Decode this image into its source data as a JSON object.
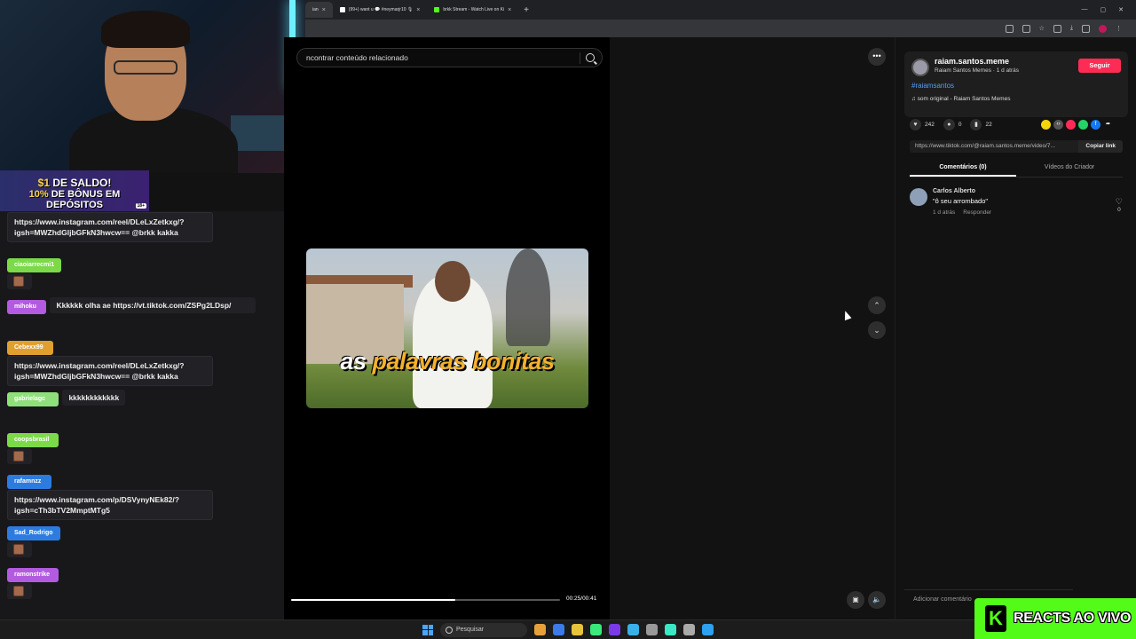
{
  "browser": {
    "tabs": [
      {
        "label": "ian",
        "active": true
      },
      {
        "label": "(99+) want u 💬 #neymarjr10 🎙",
        "active": false
      },
      {
        "label": "brkk Stream - Watch Live on Ki",
        "active": false
      }
    ],
    "new_tab": "+"
  },
  "promo": {
    "line1_hl": "$1",
    "line1_rest": " DE SALDO!",
    "line2_hl": "10%",
    "line2_rest": " DE BÔNUS EM DEPÓSITOS",
    "age_badge": "18+"
  },
  "chat": {
    "messages": [
      {
        "user": "",
        "user_color": "#6b5a3a",
        "text": "https://www.instagram.com/reel/DLeLxZetkxg/?igsh=MWZhdGljbGFkN3hwcw== @brkk kakka",
        "kind": "box"
      },
      {
        "user": "ciaoiarrecmi1",
        "user_color": "#7bd94a",
        "text": "",
        "kind": "emote"
      },
      {
        "user": "mihoku",
        "user_color": "#b25be0",
        "text": "Kkkkkk olha ae https://vt.tiktok.com/ZSPg2LDsp/",
        "kind": "plain"
      },
      {
        "user": "Cebexx99",
        "user_color": "#e0a030",
        "text": "https://www.instagram.com/reel/DLeLxZetkxg/?igsh=MWZhdGljbGFkN3hwcw== @brkk kakka",
        "kind": "box"
      },
      {
        "user": "gabrielagc",
        "user_color": "#8fe07a",
        "text": "kkkkkkkkkkkk",
        "kind": "short"
      },
      {
        "user": "coopsbrasil",
        "user_color": "#7bd94a",
        "text": "",
        "kind": "emote"
      },
      {
        "user": "rafamnzz",
        "user_color": "#2e7be0",
        "text": "https://www.instagram.com/p/DSVynyNEk82/?igsh=cTh3bTV2MmptMTg5",
        "kind": "box"
      },
      {
        "user": "Sad_Rodrigo",
        "user_color": "#2e7be0",
        "text": "",
        "kind": "emote"
      },
      {
        "user": "ramonstrike",
        "user_color": "#b25be0",
        "text": "",
        "kind": "emote"
      }
    ]
  },
  "video": {
    "search_placeholder": "ncontrar conteúdo relacionado",
    "caption_plain": "as ",
    "caption_accent": "palavras bonitas",
    "time": "00:25/00:41",
    "progress": 0.61,
    "more_label": "•••",
    "up_label": "⌃",
    "down_label": "⌄"
  },
  "post": {
    "username": "raiam.santos.meme",
    "subtitle": "Raiam Santos Memes · 1 d atrás",
    "follow_label": "Seguir",
    "hashtag": "#raiamsantos",
    "sound": "♫ som original - Raiam Santos Memes",
    "likes": "242",
    "comments": "0",
    "saves": "22",
    "link": "https://www.tiktok.com/@raiam.santos.meme/video/7...",
    "copy_label": "Copiar link",
    "tab_comments": "Comentários (0)",
    "tab_creator": "Vídeos do Criador",
    "share_colors": [
      "#f4d60a",
      "#555555",
      "#fe2c55",
      "#25d366",
      "#1877f2"
    ]
  },
  "comment": {
    "author": "Carlos Alberto",
    "text": "\"ô seu arrombado\"",
    "time": "1 d atrás",
    "reply": "Responder",
    "likes": "0"
  },
  "comment_input": {
    "placeholder": "Adicionar comentário"
  },
  "taskbar": {
    "search": "Pesquisar",
    "apps": [
      "#e8a13a",
      "#3a7be8",
      "#e8c43a",
      "#3ae87b",
      "#7b3ae8",
      "#3ab0e8",
      "#999999",
      "#3ae8c4",
      "#aaaaaa",
      "#2ea0f0"
    ]
  },
  "reacts_badge": {
    "logo": "K",
    "text": "REACTS AO VIVO"
  }
}
